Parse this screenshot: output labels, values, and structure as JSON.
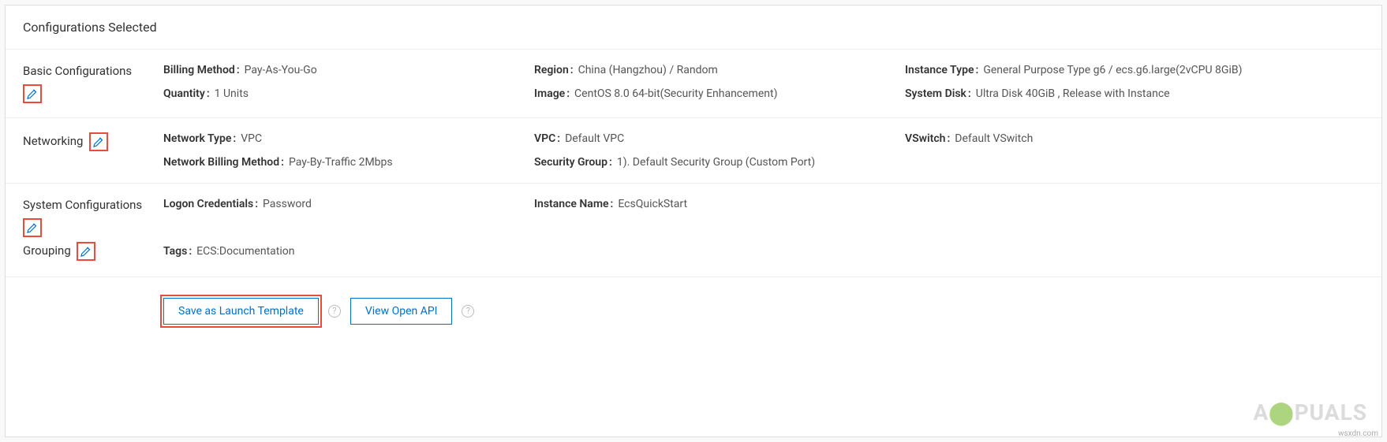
{
  "title": "Configurations Selected",
  "sections": {
    "basic": {
      "label": "Basic Configurations",
      "rows": {
        "billing_method": {
          "key": "Billing Method",
          "val": "Pay-As-You-Go"
        },
        "quantity": {
          "key": "Quantity",
          "val": "1 Units"
        },
        "region": {
          "key": "Region",
          "val": "China (Hangzhou) / Random"
        },
        "image": {
          "key": "Image",
          "val": "CentOS 8.0 64-bit(Security Enhancement)"
        },
        "instance_type": {
          "key": "Instance Type",
          "val": "General Purpose Type g6 / ecs.g6.large(2vCPU 8GiB)"
        },
        "system_disk": {
          "key": "System Disk",
          "val": "Ultra Disk 40GiB , Release with Instance"
        }
      }
    },
    "networking": {
      "label": "Networking",
      "rows": {
        "network_type": {
          "key": "Network Type",
          "val": "VPC"
        },
        "billing_method": {
          "key": "Network Billing Method",
          "val": "Pay-By-Traffic 2Mbps"
        },
        "vpc": {
          "key": "VPC",
          "val": "Default VPC"
        },
        "security_group": {
          "key": "Security Group",
          "val": "1). Default Security Group (Custom Port)"
        },
        "vswitch": {
          "key": "VSwitch",
          "val": "Default VSwitch"
        }
      }
    },
    "system": {
      "label": "System Configurations",
      "rows": {
        "logon": {
          "key": "Logon Credentials",
          "val": "Password"
        },
        "instance_name": {
          "key": "Instance Name",
          "val": "EcsQuickStart"
        }
      }
    },
    "grouping": {
      "label": "Grouping",
      "rows": {
        "tags": {
          "key": "Tags",
          "val": "ECS:Documentation"
        }
      }
    }
  },
  "buttons": {
    "save_template": "Save as Launch Template",
    "view_api": "View Open API"
  },
  "watermark": "A PUALS",
  "source": "wsxdn.com"
}
